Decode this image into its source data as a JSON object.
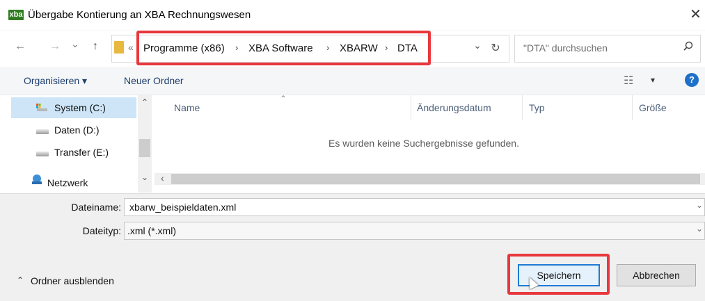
{
  "window": {
    "title": "Übergabe Kontierung an XBA Rechnungswesen",
    "app_icon_text": "xba",
    "close_glyph": "✕"
  },
  "nav": {
    "back_glyph": "←",
    "forward_glyph": "→",
    "recent_glyph": "⌄",
    "up_glyph": "↑",
    "overflow_glyph": "«",
    "refresh_glyph": "↻",
    "dropdown_glyph": "⌄"
  },
  "breadcrumb": {
    "items": [
      "Programme (x86)",
      "XBA Software",
      "XBARW",
      "DTA"
    ],
    "separator": "›"
  },
  "search": {
    "placeholder": "\"DTA\" durchsuchen",
    "icon": "search-icon"
  },
  "commandbar": {
    "organize": "Organisieren ▾",
    "new_folder": "Neuer Ordner",
    "view_glyph": "☷",
    "view_dropdown": "▾",
    "help": "?"
  },
  "navpane": {
    "items": [
      {
        "label": "System (C:)",
        "icon": "system-drive-icon",
        "selected": true
      },
      {
        "label": "Daten (D:)",
        "icon": "drive-icon",
        "selected": false
      },
      {
        "label": "Transfer (E:)",
        "icon": "drive-icon",
        "selected": false
      },
      {
        "label": "Netzwerk",
        "icon": "network-icon",
        "selected": false
      }
    ],
    "scroll_up": "⌃",
    "scroll_down": "⌄"
  },
  "list": {
    "sort_indicator": "⌃",
    "columns": [
      "Name",
      "Änderungsdatum",
      "Typ",
      "Größe"
    ],
    "empty_message": "Es wurden keine Suchergebnisse gefunden.",
    "hscroll_left": "‹",
    "hscroll_right": "›"
  },
  "form": {
    "filename_label": "Dateiname:",
    "filename_value": "xbarw_beispieldaten.xml",
    "filetype_label": "Dateityp:",
    "filetype_value": ".xml (*.xml)",
    "dropdown_glyph": "⌄"
  },
  "footer": {
    "hide_folders": "Ordner ausblenden",
    "hide_glyph": "⌃",
    "save": "Speichern",
    "cancel": "Abbrechen"
  },
  "colors": {
    "highlight": "#e8383d",
    "accent": "#1e7bd4",
    "app_icon": "#2f7d1f"
  }
}
